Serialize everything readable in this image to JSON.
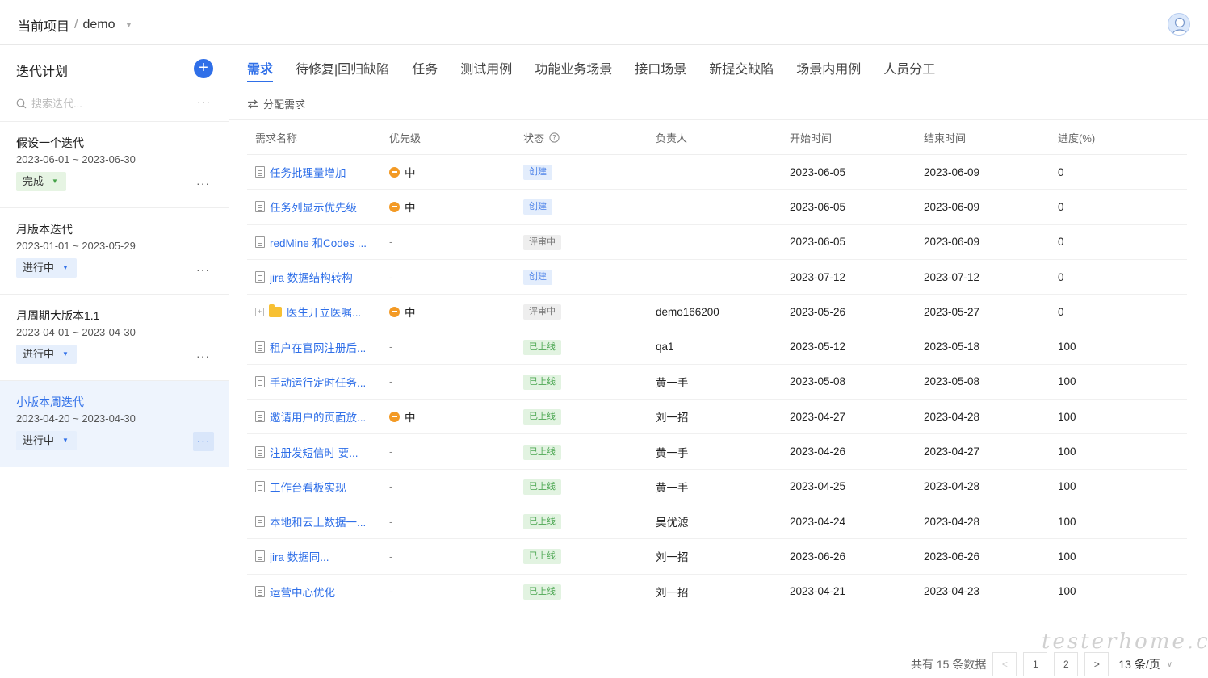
{
  "header": {
    "breadcrumb_root": "当前项目",
    "breadcrumb_sep": "/",
    "project": "demo"
  },
  "sidebar": {
    "title": "迭代计划",
    "add_icon": "plus-circle-icon",
    "search_placeholder": "搜索迭代...",
    "iterations": [
      {
        "name": "假设一个迭代",
        "dates": "2023-06-01 ~ 2023-06-30",
        "status": "完成"
      },
      {
        "name": "月版本迭代",
        "dates": "2023-01-01 ~ 2023-05-29",
        "status": "进行中"
      },
      {
        "name": "月周期大版本1.1",
        "dates": "2023-04-01 ~ 2023-04-30",
        "status": "进行中"
      },
      {
        "name": "小版本周迭代",
        "dates": "2023-04-20 ~ 2023-04-30",
        "status": "进行中"
      }
    ]
  },
  "tabs": [
    "需求",
    "待修复|回归缺陷",
    "任务",
    "测试用例",
    "功能业务场景",
    "接口场景",
    "新提交缺陷",
    "场景内用例",
    "人员分工"
  ],
  "assign_label": "分配需求",
  "table": {
    "headers": [
      "需求名称",
      "优先级",
      "状态",
      "负责人",
      "开始时间",
      "结束时间",
      "进度(%)"
    ],
    "rows": [
      {
        "name": "任务批理量增加",
        "priority": "中",
        "status": "创建",
        "owner": "",
        "start": "2023-06-05",
        "end": "2023-06-09",
        "progress": "0"
      },
      {
        "name": "任务列显示优先级",
        "priority": "中",
        "status": "创建",
        "owner": "",
        "start": "2023-06-05",
        "end": "2023-06-09",
        "progress": "0"
      },
      {
        "name": "redMine 和Codes ...",
        "priority": "-",
        "status": "评审中",
        "owner": "",
        "start": "2023-06-05",
        "end": "2023-06-09",
        "progress": "0"
      },
      {
        "name": "jira 数据结构转构",
        "priority": "-",
        "status": "创建",
        "owner": "",
        "start": "2023-07-12",
        "end": "2023-07-12",
        "progress": "0"
      },
      {
        "name": "医生开立医嘱...",
        "priority": "中",
        "status": "评审中",
        "owner": "demo166200",
        "start": "2023-05-26",
        "end": "2023-05-27",
        "progress": "0",
        "folder": true
      },
      {
        "name": "租户在官网注册后...",
        "priority": "-",
        "status": "已上线",
        "owner": "qa1",
        "start": "2023-05-12",
        "end": "2023-05-18",
        "progress": "100"
      },
      {
        "name": "手动运行定时任务...",
        "priority": "-",
        "status": "已上线",
        "owner": "黄一手",
        "start": "2023-05-08",
        "end": "2023-05-08",
        "progress": "100"
      },
      {
        "name": "邀请用户的页面放...",
        "priority": "中",
        "status": "已上线",
        "owner": "刘一招",
        "start": "2023-04-27",
        "end": "2023-04-28",
        "progress": "100"
      },
      {
        "name": "注册发短信时 要...",
        "priority": "-",
        "status": "已上线",
        "owner": "黄一手",
        "start": "2023-04-26",
        "end": "2023-04-27",
        "progress": "100"
      },
      {
        "name": "工作台看板实现",
        "priority": "-",
        "status": "已上线",
        "owner": "黄一手",
        "start": "2023-04-25",
        "end": "2023-04-28",
        "progress": "100"
      },
      {
        "name": "本地和云上数据一...",
        "priority": "-",
        "status": "已上线",
        "owner": "吴优滤",
        "start": "2023-04-24",
        "end": "2023-04-28",
        "progress": "100"
      },
      {
        "name": "jira 数据同...",
        "priority": "-",
        "status": "已上线",
        "owner": "刘一招",
        "start": "2023-06-26",
        "end": "2023-06-26",
        "progress": "100"
      },
      {
        "name": "运营中心优化",
        "priority": "-",
        "status": "已上线",
        "owner": "刘一招",
        "start": "2023-04-21",
        "end": "2023-04-23",
        "progress": "100"
      }
    ]
  },
  "pagination": {
    "total_text": "共有 15 条数据",
    "pages": [
      "1",
      "2"
    ],
    "page_size": "13 条/页"
  },
  "watermark": "testerhome.com",
  "colors": {
    "accent": "#2f6fe8",
    "priority_mid": "#f39a25",
    "online": "#4ea854"
  }
}
